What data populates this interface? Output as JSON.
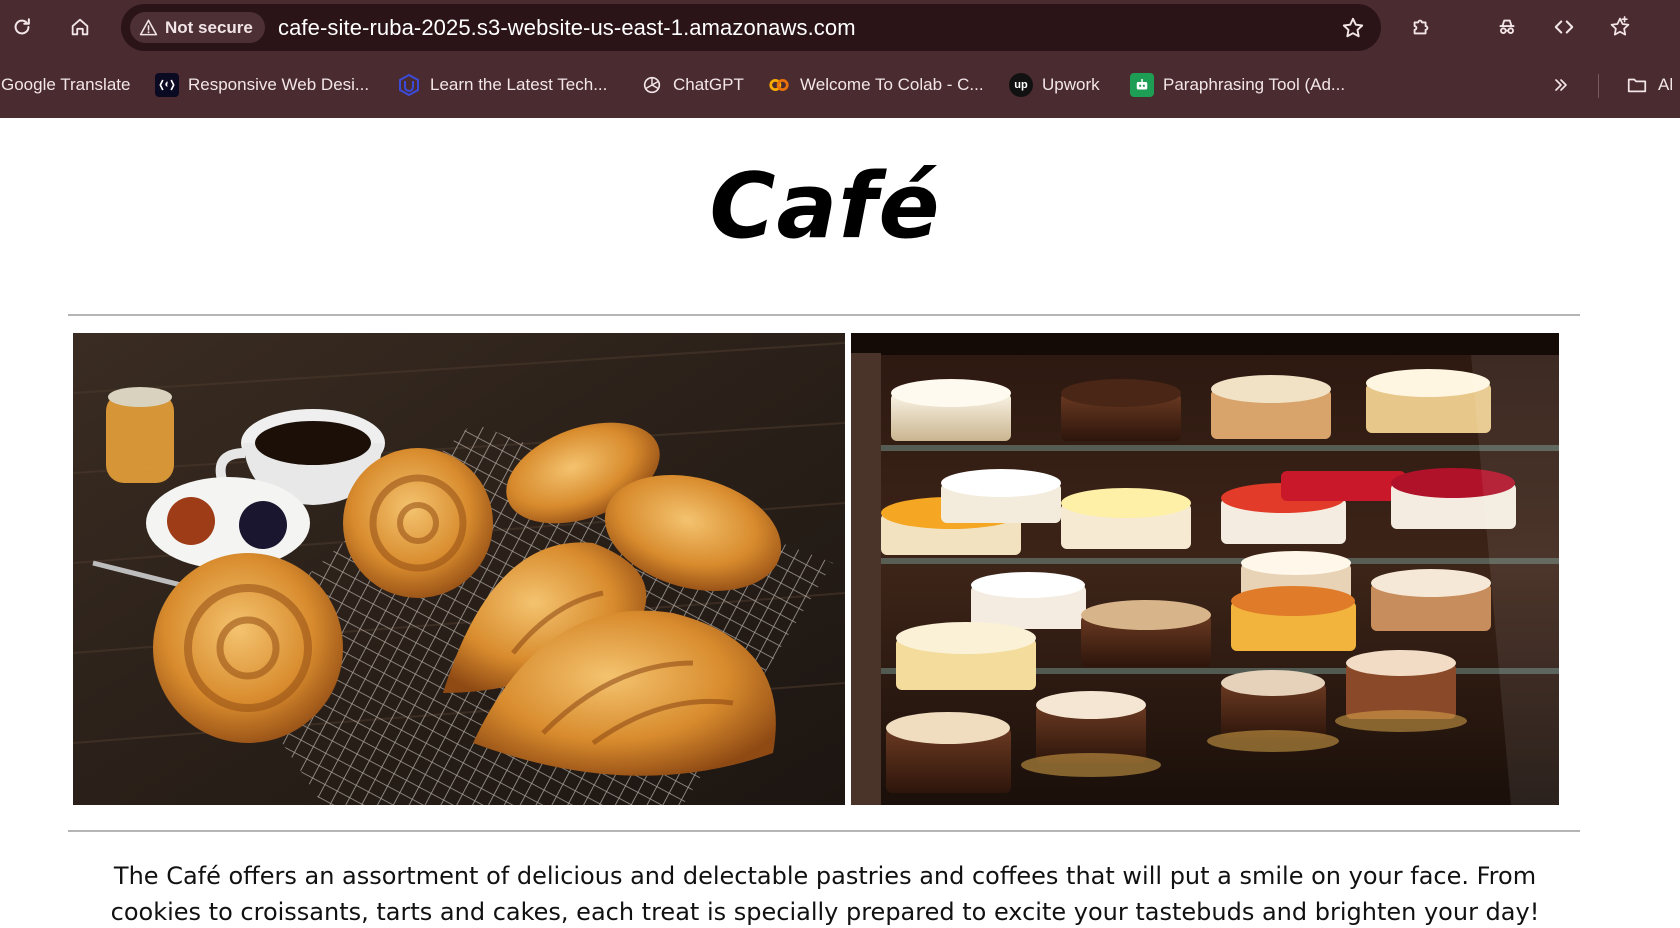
{
  "browser": {
    "security_label": "Not secure",
    "url": "cafe-site-ruba-2025.s3-website-us-east-1.amazonaws.com",
    "toolbar_icons": [
      "reload-icon",
      "home-icon",
      "bookmark-star-icon",
      "extensions-icon",
      "incognito-icon",
      "code-icon",
      "bookmarks-star-icon"
    ],
    "bookmarks": [
      {
        "label": "Google Translate",
        "icon": "translate-icon"
      },
      {
        "label": "Responsive Web Desi...",
        "icon": "freecodecamp-icon"
      },
      {
        "label": "Learn the Latest Tech...",
        "icon": "udacity-icon"
      },
      {
        "label": "ChatGPT",
        "icon": "chatgpt-icon"
      },
      {
        "label": "Welcome To Colab - C...",
        "icon": "colab-icon"
      },
      {
        "label": "Upwork",
        "icon": "upwork-icon"
      },
      {
        "label": "Paraphrasing Tool (Ad...",
        "icon": "paraphrasing-icon"
      },
      {
        "label": "Al",
        "icon": "folder-icon"
      }
    ],
    "colors": {
      "chrome": "#4a2b30",
      "omnibox": "#2b1418",
      "text": "#f2e6e8"
    }
  },
  "page": {
    "heading": "Café",
    "images": [
      {
        "name": "pastries-coffee-photo"
      },
      {
        "name": "cake-display-case-photo"
      }
    ],
    "description": "The Café offers an assortment of delicious and delectable pastries and coffees that will put a smile on your face. From cookies to croissants, tarts and cakes, each treat is specially prepared to excite your tastebuds and brighten your day!"
  }
}
